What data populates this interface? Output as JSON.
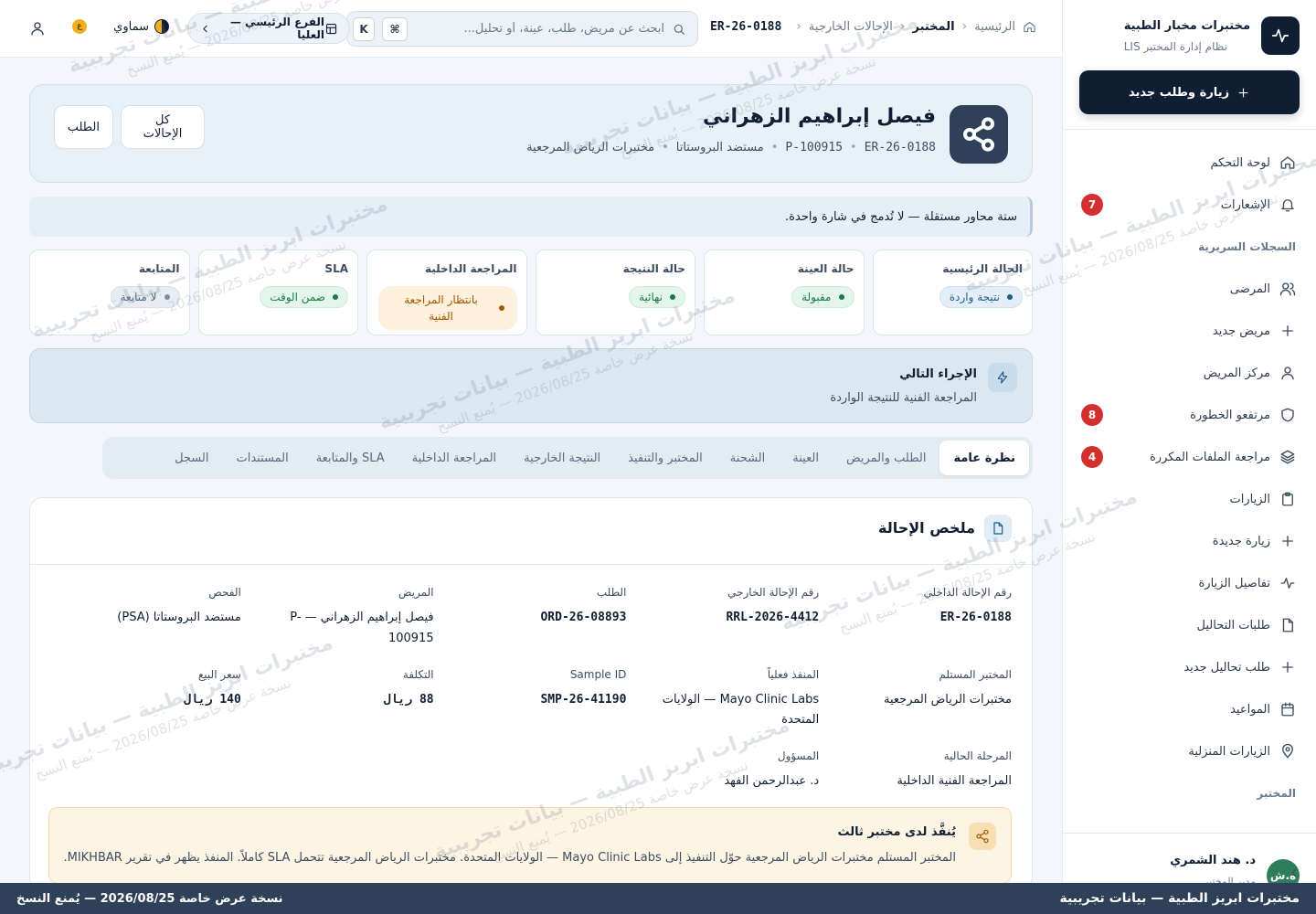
{
  "sidebar": {
    "brand_name": "مختبرات مخبار الطبية",
    "brand_subtitle": "نظام إدارة المختبر LIS",
    "new_visit_label": "زيارة وطلب جديد",
    "items": [
      {
        "label": "لوحة التحكم",
        "icon": "home-icon"
      },
      {
        "label": "الإشعارات",
        "icon": "bell-icon",
        "badge": "7"
      },
      {
        "label": "المرضى",
        "icon": "users-icon"
      },
      {
        "label": "مريض جديد",
        "icon": "plus-icon"
      },
      {
        "label": "مركز المريض",
        "icon": "user-icon"
      },
      {
        "label": "مرتفعو الخطورة",
        "icon": "shield-icon",
        "badge": "8"
      },
      {
        "label": "مراجعة الملفات المكررة",
        "icon": "layers-icon",
        "badge": "4"
      },
      {
        "label": "الزيارات",
        "icon": "clipboard-icon"
      },
      {
        "label": "زيارة جديدة",
        "icon": "plus-icon"
      },
      {
        "label": "تفاصيل الزيارة",
        "icon": "activity-icon"
      },
      {
        "label": "طلبات التحاليل",
        "icon": "file-icon"
      },
      {
        "label": "طلب تحاليل جديد",
        "icon": "plus-icon"
      },
      {
        "label": "المواعيد",
        "icon": "calendar-icon"
      },
      {
        "label": "الزيارات المنزلية",
        "icon": "map-pin-icon"
      }
    ],
    "section_clinical": "السجلات السريرية",
    "section_lab": "المختبر",
    "user": {
      "initials": "ه.ش",
      "name": "د. هند الشمري",
      "role": "مدير المختبر"
    }
  },
  "topbar": {
    "breadcrumb": [
      "الرئيسية",
      "المختبر",
      "الإحالات الخارجية"
    ],
    "current_id": "ER-26-0188",
    "search_placeholder": "ابحث عن مريض، طلب، عينة، أو تحليل...",
    "shortcut_keys": [
      "⌘",
      "K"
    ],
    "branch": "الفرع الرئيسي — العليا",
    "theme": "سماوي",
    "lang_badge": "ع"
  },
  "header": {
    "patient_name": "فيصل إبراهيم الزهراني",
    "referral_id": "ER-26-0188",
    "patient_id": "P-100915",
    "test": "مستضد البروستاتا",
    "lab": "مختبرات الرياض المرجعية",
    "btn_all": "كل الإحالات",
    "btn_order": "الطلب"
  },
  "note": "ستة محاور مستقلة — لا تُدمج في شارة واحدة.",
  "status_cards": [
    {
      "title": "الحالة الرئيسية",
      "value": "نتيجة واردة",
      "tone": "info"
    },
    {
      "title": "حالة العينة",
      "value": "مقبولة",
      "tone": "green"
    },
    {
      "title": "حالة النتيجة",
      "value": "نهائية",
      "tone": "green"
    },
    {
      "title": "المراجعة الداخلية",
      "value": "بانتظار المراجعة الفنية",
      "tone": "amber"
    },
    {
      "title": "SLA",
      "value": "ضمن الوقت",
      "tone": "green"
    },
    {
      "title": "المتابعة",
      "value": "لا متابعة",
      "tone": "gray"
    }
  ],
  "next_action": {
    "title": "الإجراء التالي",
    "description": "المراجعة الفنية للنتيجة الواردة"
  },
  "tabs": [
    "نظرة عامة",
    "الطلب والمريض",
    "العينة",
    "الشحنة",
    "المختبر والتنفيذ",
    "النتيجة الخارجية",
    "المراجعة الداخلية",
    "SLA والمتابعة",
    "المستندات",
    "السجل"
  ],
  "summary": {
    "title": "ملخص الإحالة",
    "fields": [
      {
        "label": "رقم الإحالة الداخلي",
        "value": "ER-26-0188",
        "mono": true
      },
      {
        "label": "رقم الإحالة الخارجي",
        "value": "RRL-2026-4412",
        "mono": true
      },
      {
        "label": "الطلب",
        "value": "ORD-26-08893",
        "mono": true
      },
      {
        "label": "المريض",
        "value": "فيصل إبراهيم الزهراني — P-100915",
        "mono": false
      },
      {
        "label": "الفحص",
        "value": "مستضد البروستاتا (PSA)",
        "mono": false
      },
      {
        "label": "المختبر المستلم",
        "value": "مختبرات الرياض المرجعية",
        "mono": false
      },
      {
        "label": "المنفذ فعلياً",
        "value": "Mayo Clinic Labs — الولايات المتحدة",
        "mono": false
      },
      {
        "label": "Sample ID",
        "value": "SMP-26-41190",
        "mono": true
      },
      {
        "label": "التكلفة",
        "value": "88 ريال",
        "mono": true
      },
      {
        "label": "سعر البيع",
        "value": "140 ريال",
        "mono": true
      },
      {
        "label": "المرحلة الحالية",
        "value": "المراجعة الفنية الداخلية",
        "mono": false
      },
      {
        "label": "المسؤول",
        "value": "د. عبدالرحمن الفهد",
        "mono": false
      }
    ],
    "third_party": {
      "title": "يُنفَّذ لدى مختبر ثالث",
      "description": "المختبر المستلم مختبرات الرياض المرجعية حوّل التنفيذ إلى Mayo Clinic Labs — الولايات المتحدة. مختبرات الرياض المرجعية تتحمل SLA كاملاً. المنفذ يظهر في تقرير MIKHBAR."
    }
  },
  "footer": {
    "right": "مختبرات ابريز الطبية — بيانات تجريبية",
    "left": "نسخة عرض خاصة 2026/08/25 — يُمنع النسخ"
  },
  "watermark": {
    "line1": "مختبرات ابريز الطبية — بيانات تجريبية",
    "line2": "نسخة عرض خاصة 2026/08/25 — يُمنع النسخ"
  },
  "colors": {
    "navy": "#0f1e33",
    "accent": "#1e5c8a",
    "danger": "#d32f2f",
    "success": "#1d7a4a",
    "warning": "#a05a00"
  }
}
